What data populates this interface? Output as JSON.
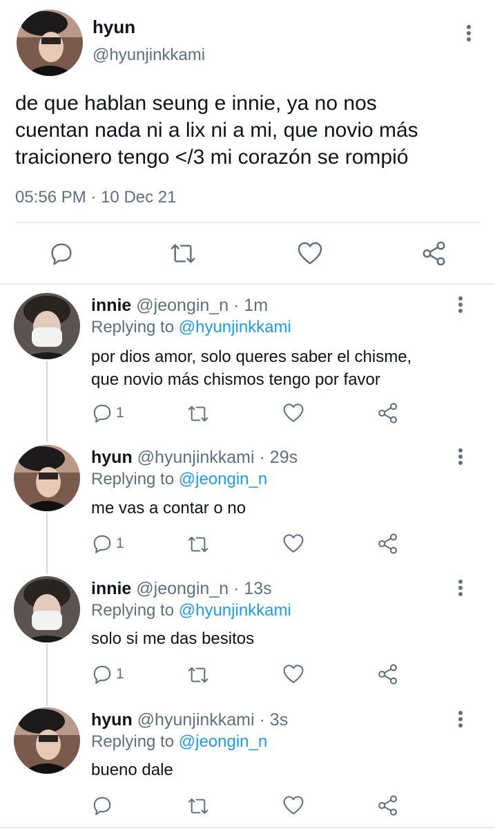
{
  "main_tweet": {
    "name": "hyun",
    "handle": "@hyunjinkkami",
    "text_lines": [
      "de que hablan seung e innie, ya no nos",
      "cuentan nada ni a lix ni a mi, que novio más",
      "traicionero tengo </3  mi corazón se rompió"
    ],
    "time": "05:56 PM",
    "sep": "·",
    "date": "10 Dec 21"
  },
  "replies": [
    {
      "name": "innie",
      "handle": "@jeongin_n",
      "time": "· 1m",
      "replying_label": "Replying to",
      "replying_to": "@hyunjinkkami",
      "lines": [
        "por dios amor, solo queres saber el chisme,",
        "que novio más chismos tengo por favor"
      ],
      "reply_count": "1"
    },
    {
      "name": "hyun",
      "handle": "@hyunjinkkami",
      "time": "· 29s",
      "replying_label": "Replying to",
      "replying_to": "@jeongin_n",
      "lines": [
        "me vas a contar o no"
      ],
      "reply_count": "1"
    },
    {
      "name": "innie",
      "handle": "@jeongin_n",
      "time": "· 13s",
      "replying_label": "Replying to",
      "replying_to": "@hyunjinkkami",
      "lines": [
        "solo si me das besitos"
      ],
      "reply_count": "1"
    },
    {
      "name": "hyun",
      "handle": "@hyunjinkkami",
      "time": "· 3s",
      "replying_label": "Replying to",
      "replying_to": "@jeongin_n",
      "lines": [
        "bueno dale"
      ],
      "reply_count": ""
    }
  ],
  "icons": {
    "reply": "reply-icon",
    "retweet": "retweet-icon",
    "like": "heart-icon",
    "share": "share-icon",
    "more": "more-options-icon"
  },
  "colors": {
    "link": "#1d9bf0",
    "secondary": "#5b7083",
    "text": "#0f1419"
  }
}
